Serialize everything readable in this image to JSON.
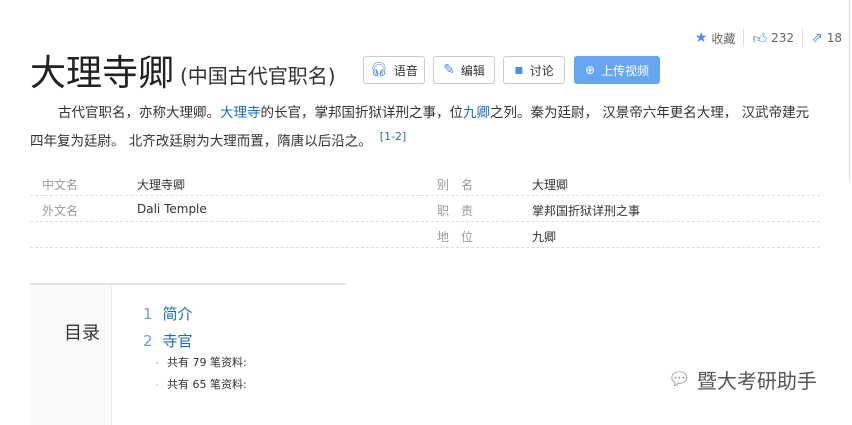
{
  "header": {
    "title": "大理寺卿",
    "subtitle": "(中国古代官职名)"
  },
  "actions": {
    "collect": "收藏",
    "likes": "232",
    "shares": "18"
  },
  "buttons": {
    "voice": "语音",
    "edit": "编辑",
    "discuss": "讨论",
    "upload": "上传视频"
  },
  "summary": {
    "p1": "古代官职名，亦称大理卿。",
    "link1": "大理寺",
    "p2": "的长官，掌邦国折狱详刑之事，位",
    "link2": "九卿",
    "p3": "之列。秦为廷尉， 汉景帝六年更名大理， 汉武帝建元四年复为廷尉。 北齐改廷尉为大理而置，隋唐以后沿之。",
    "ref": "[1-2]"
  },
  "infobox": {
    "left": [
      {
        "label": "中文名",
        "value": "大理寺卿"
      },
      {
        "label": "外文名",
        "value": "Dali Temple"
      }
    ],
    "right": [
      {
        "label": "别　名",
        "value": "大理卿"
      },
      {
        "label": "职　责",
        "value": "掌邦国折狱详刑之事"
      },
      {
        "label": "地　位",
        "value": "九卿"
      }
    ]
  },
  "toc": {
    "heading": "目录",
    "items": [
      {
        "num": "1",
        "label": "简介"
      },
      {
        "num": "2",
        "label": "寺官"
      }
    ],
    "subitems": [
      "共有 79 笔资料:",
      "共有 65 笔资料:"
    ]
  },
  "watermark": "暨大考研助手"
}
